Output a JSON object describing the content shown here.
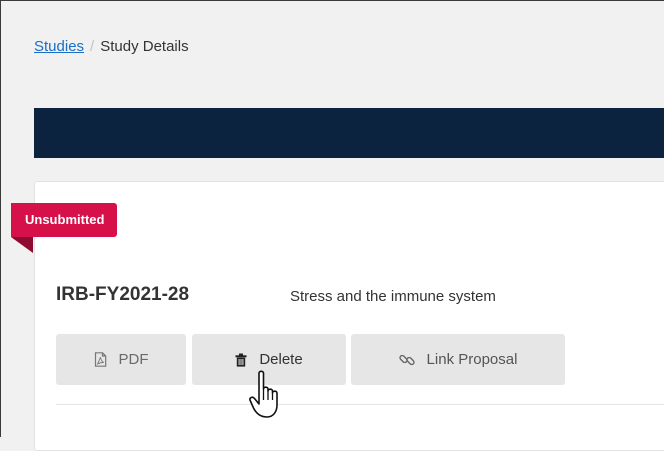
{
  "breadcrumb": {
    "link_label": "Studies",
    "separator": "/",
    "current_label": "Study Details"
  },
  "study": {
    "status_badge": "Unsubmitted",
    "id": "IRB-FY2021-28",
    "title": "Stress and the immune system"
  },
  "actions": {
    "pdf_label": "PDF",
    "delete_label": "Delete",
    "link_proposal_label": "Link Proposal"
  },
  "icons": {
    "pdf": "pdf-file-icon",
    "delete": "trash-icon",
    "link": "link-icon",
    "cursor": "hand-pointer-cursor"
  },
  "colors": {
    "badge": "#d6114a",
    "navbar": "#0c2340",
    "link": "#1a6ec5"
  }
}
